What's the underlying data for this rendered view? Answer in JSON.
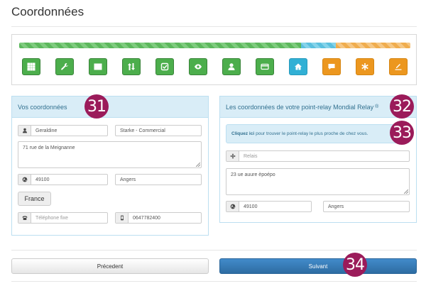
{
  "page": {
    "title": "Coordonnées"
  },
  "stepper": {
    "progress": {
      "completed_fraction": 0.72,
      "current_fraction": 0.09,
      "remaining_fraction": 0.19
    },
    "steps": [
      {
        "icon": "grid-icon",
        "state": "done",
        "color": "#4cae4c"
      },
      {
        "icon": "wrench-icon",
        "state": "done",
        "color": "#4cae4c"
      },
      {
        "icon": "list-icon",
        "state": "done",
        "color": "#4cae4c"
      },
      {
        "icon": "sort-icon",
        "state": "done",
        "color": "#4cae4c"
      },
      {
        "icon": "check-icon",
        "state": "done",
        "color": "#4cae4c"
      },
      {
        "icon": "eye-icon",
        "state": "done",
        "color": "#4cae4c"
      },
      {
        "icon": "user-icon",
        "state": "done",
        "color": "#4cae4c"
      },
      {
        "icon": "card-icon",
        "state": "done",
        "color": "#4cae4c"
      },
      {
        "icon": "home-icon",
        "state": "current",
        "color": "#31b0d5"
      },
      {
        "icon": "comment-icon",
        "state": "todo",
        "color": "#ec971f"
      },
      {
        "icon": "asterisk-icon",
        "state": "todo",
        "color": "#ec971f"
      },
      {
        "icon": "edit-icon",
        "state": "todo",
        "color": "#ec971f"
      }
    ]
  },
  "left_panel": {
    "title": "Vos coordonnées",
    "first_name": "Geraldine",
    "last_name": "Starke - Commercial",
    "address": "71 rue de la Meignanne",
    "postal_code": "49100",
    "city": "Angers",
    "country": "France",
    "phone_placeholder": "Téléphone fixe",
    "mobile": "0647782400"
  },
  "right_panel": {
    "title": "Les coordonnées de votre point-relay Mondial Relay",
    "title_mark": "®",
    "alert_link": "Cliquez ici",
    "alert_text": "pour trouver le point-relay le plus proche de chez vous.",
    "relay_name": "Relais",
    "address": "23 ue auure èpoépo",
    "postal_code": "49100",
    "city": "Angers"
  },
  "buttons": {
    "previous": "Précedent",
    "next": "Suivant"
  },
  "badges": {
    "b31": "31",
    "b32": "32",
    "b33": "33",
    "b34": "34"
  },
  "colors": {
    "success": "#5cb85c",
    "info": "#5bc0de",
    "warning": "#f0ad4e",
    "primary": "#428bca",
    "badge": "#9b1b5a"
  }
}
